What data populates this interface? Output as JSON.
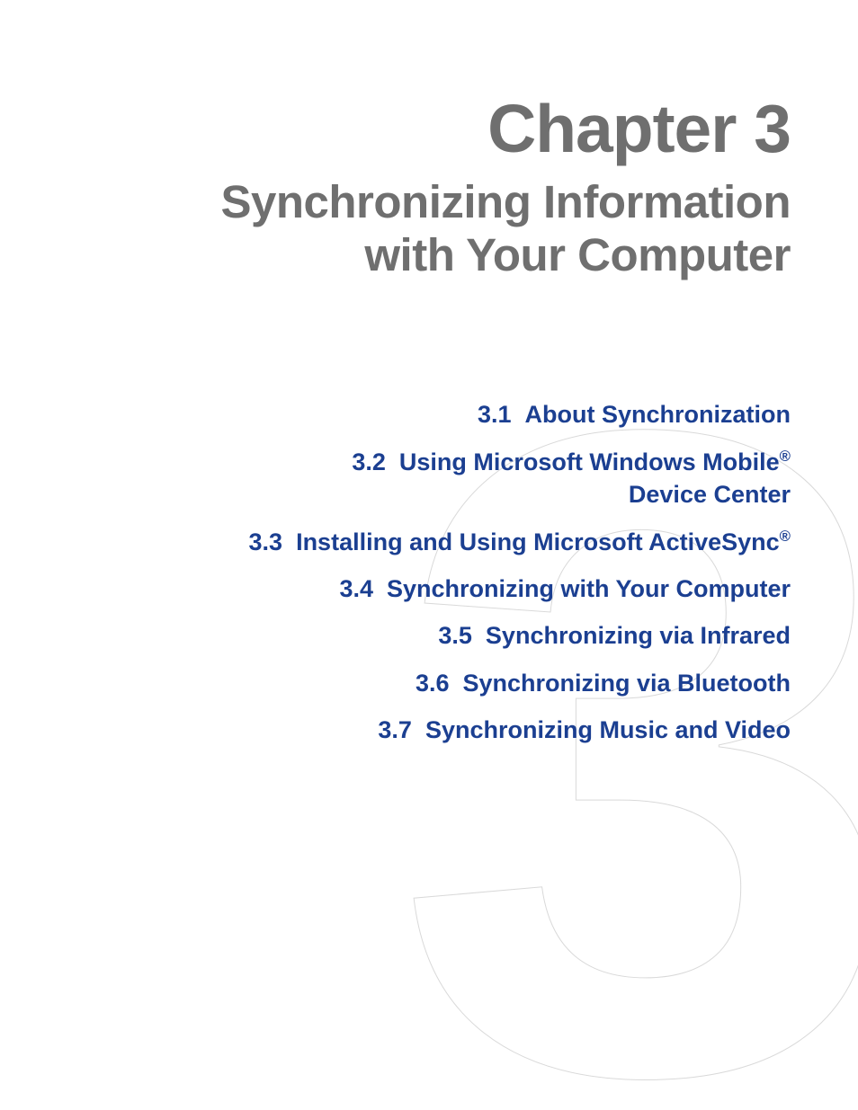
{
  "chapter": {
    "label": "Chapter 3",
    "title_line1": "Synchronizing Information",
    "title_line2": "with Your Computer",
    "bg_number": "3"
  },
  "toc": [
    {
      "html": "3.1&nbsp;&nbsp;About Synchronization"
    },
    {
      "html": "3.2&nbsp;&nbsp;Using Microsoft Windows Mobile<sup>&reg;</sup><br>Device Center"
    },
    {
      "html": "3.3&nbsp;&nbsp;Installing and Using Microsoft ActiveSync<sup>&reg;</sup>"
    },
    {
      "html": "3.4&nbsp;&nbsp;Synchronizing with Your Computer"
    },
    {
      "html": "3.5&nbsp;&nbsp;Synchronizing via Infrared"
    },
    {
      "html": "3.6&nbsp;&nbsp;Synchronizing via Bluetooth"
    },
    {
      "html": "3.7&nbsp;&nbsp;Synchronizing Music and Video"
    }
  ]
}
